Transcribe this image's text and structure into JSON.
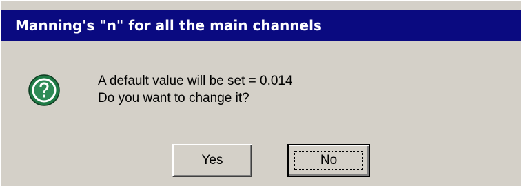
{
  "dialog": {
    "title": "Manning's \"n\" for all the main channels",
    "icon": "question-icon",
    "message_line1": "A default value will be set = 0.014",
    "message_line2": "Do you want to change it?",
    "buttons": {
      "yes_label": "Yes",
      "no_label": "No"
    },
    "colors": {
      "title_bar": "#0a0a80",
      "face": "#d4d0c8",
      "icon_green": "#2e8b57"
    }
  }
}
